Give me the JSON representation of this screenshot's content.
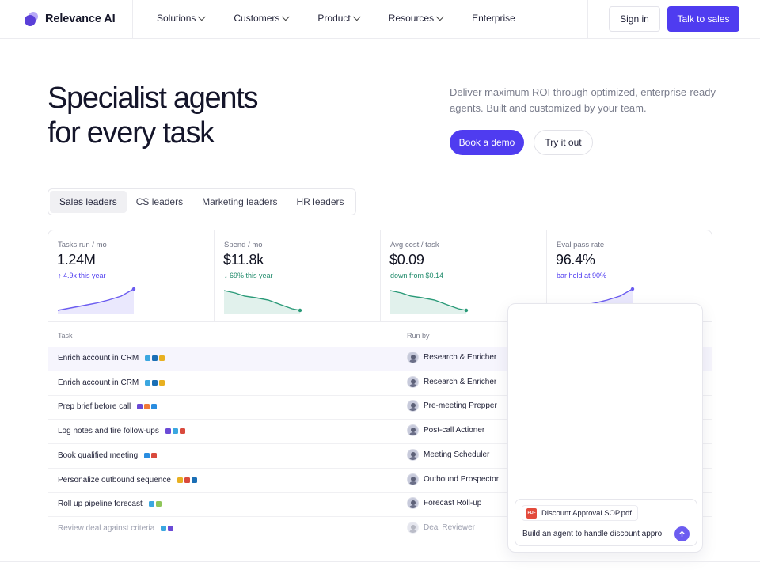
{
  "brand": {
    "name": "Relevance AI",
    "accent": "#4f3cf0"
  },
  "nav": {
    "links": [
      {
        "label": "Solutions",
        "dropdown": true
      },
      {
        "label": "Customers",
        "dropdown": true
      },
      {
        "label": "Product",
        "dropdown": true
      },
      {
        "label": "Resources",
        "dropdown": true
      },
      {
        "label": "Enterprise",
        "dropdown": false
      }
    ],
    "signin_label": "Sign in",
    "sales_label": "Talk to sales"
  },
  "hero": {
    "title_line1": "Specialist agents",
    "title_line2": "for every task",
    "subtitle": "Deliver maximum ROI through optimized, enterprise-ready agents. Built and customized by your team.",
    "demo_label": "Book a demo",
    "try_label": "Try it out"
  },
  "tabs": [
    "Sales leaders",
    "CS leaders",
    "Marketing leaders",
    "HR leaders"
  ],
  "active_tab": 0,
  "stats": [
    {
      "label": "Tasks run / mo",
      "value": "1.24M",
      "delta": "↑ 4.9x this year",
      "delta_color": "#4f3cf0",
      "trend": "up",
      "color": "#6b5cf0"
    },
    {
      "label": "Spend / mo",
      "value": "$11.8k",
      "delta": "↓ 69% this year",
      "delta_color": "#1f8a6a",
      "trend": "down",
      "color": "#2a9a78"
    },
    {
      "label": "Avg cost / task",
      "value": "$0.09",
      "delta": "down from $0.14",
      "delta_color": "#1f8a6a",
      "trend": "down",
      "color": "#2a9a78"
    },
    {
      "label": "Eval pass rate",
      "value": "96.4%",
      "delta": "bar held at 90%",
      "delta_color": "#4f3cf0",
      "trend": "up",
      "color": "#6b5cf0"
    }
  ],
  "table": {
    "headers": {
      "task": "Task",
      "run_by": "Run by"
    },
    "rows": [
      {
        "task": "Enrich account in CRM",
        "tools": [
          "#3ba7e0",
          "#1b6fb5",
          "#e8b021"
        ],
        "agent": "Research & Enricher",
        "highlight": true
      },
      {
        "task": "Enrich account in CRM",
        "tools": [
          "#3ba7e0",
          "#1b6fb5",
          "#e8b021"
        ],
        "agent": "Research & Enricher"
      },
      {
        "task": "Prep brief before call",
        "tools": [
          "#6b4bd6",
          "#f07a3a",
          "#2a8de0"
        ],
        "agent": "Pre-meeting Prepper"
      },
      {
        "task": "Log notes and fire follow-ups",
        "tools": [
          "#6b4bd6",
          "#3ba7e0",
          "#d94a3d"
        ],
        "agent": "Post-call Actioner"
      },
      {
        "task": "Book qualified meeting",
        "tools": [
          "#2a8de0",
          "#d94a3d"
        ],
        "agent": "Meeting Scheduler"
      },
      {
        "task": "Personalize outbound sequence",
        "tools": [
          "#e8b021",
          "#d94a3d",
          "#1b6fb5"
        ],
        "agent": "Outbound Prospector"
      },
      {
        "task": "Roll up pipeline forecast",
        "tools": [
          "#3ba7e0",
          "#8fc65a"
        ],
        "agent": "Forecast Roll-up"
      },
      {
        "task": "Review deal against criteria",
        "tools": [
          "#3ba7e0",
          "#6b4bd6"
        ],
        "agent": "Deal Reviewer",
        "faded": true
      }
    ]
  },
  "chat": {
    "attachment": "Discount Approval SOP.pdf",
    "attachment_icon": "pdf-icon",
    "prompt": "Build an agent to handle discount appro"
  }
}
